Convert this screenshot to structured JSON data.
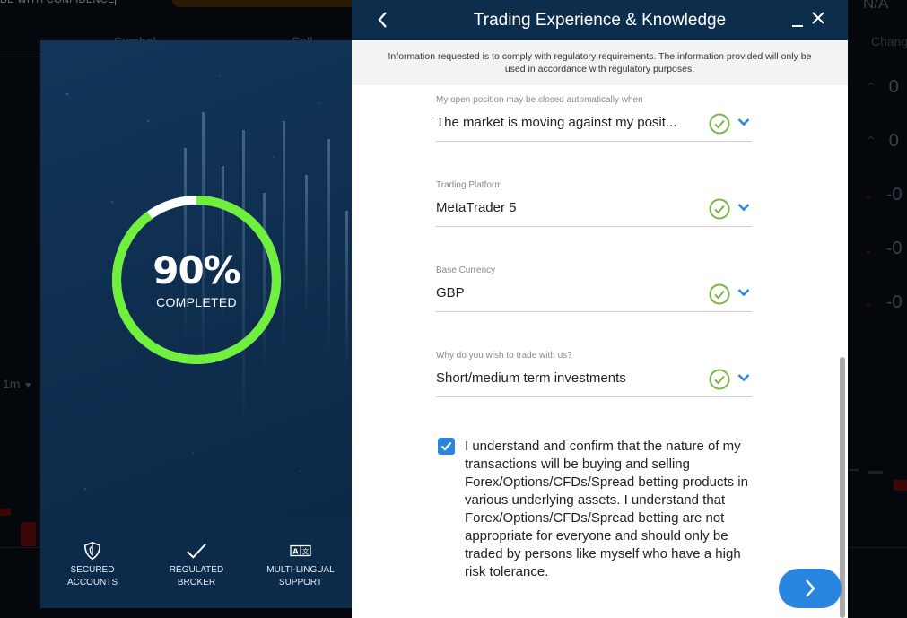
{
  "background": {
    "tagline": "DE WITH CONFIDENCE",
    "columns": {
      "symbol": "Symbol",
      "sell": "Sell",
      "change": "Change"
    },
    "na_label": "N/A",
    "change_values": [
      {
        "direction": "up",
        "value": "0"
      },
      {
        "direction": "up",
        "value": "0"
      },
      {
        "direction": "down",
        "value": "-0"
      },
      {
        "direction": "down",
        "value": "-0"
      },
      {
        "direction": "down",
        "value": "-0"
      }
    ],
    "timeframe": "1m",
    "colors": {
      "up": "#0f3a1e",
      "down": "#4a0a0a"
    }
  },
  "left_panel": {
    "progress": {
      "percent": 90,
      "percent_label": "90%",
      "status_label": "COMPLETED",
      "ring_color": "#6ff03c",
      "track_color": "#ffffff"
    },
    "features": [
      {
        "icon": "shield-icon",
        "label": "SECURED\nACCOUNTS"
      },
      {
        "icon": "checkmark-icon",
        "label": "REGULATED\nBROKER"
      },
      {
        "icon": "translate-icon",
        "label": "MULTI-LINGUAL\nSUPPORT"
      }
    ]
  },
  "modal": {
    "title": "Trading Experience & Knowledge",
    "notice": "Information requested is to comply with regulatory requirements. The information provided will only be used in accordance with regulatory purposes.",
    "fields": [
      {
        "label": "My open position may be closed automatically when",
        "value": "The market is moving against my posit...",
        "valid": true
      },
      {
        "label": "Trading Platform",
        "value": "MetaTrader 5",
        "valid": true
      },
      {
        "label": "Base Currency",
        "value": "GBP",
        "valid": true
      },
      {
        "label": "Why do you wish to trade with us?",
        "value": "Short/medium term investments",
        "valid": true
      }
    ],
    "consent": {
      "checked": true,
      "text": "I understand and confirm that the nature of my transactions will be buying and selling Forex/Options/CFDs/Spread betting products in various underlying assets. I understand that Forex/Options/CFDs/Spread betting are not appropriate for everyone and should only be traded by persons like myself who have a high risk tolerance."
    },
    "colors": {
      "header": "#0d2d4d",
      "accent": "#2a85e0",
      "valid": "#7ab648"
    }
  }
}
